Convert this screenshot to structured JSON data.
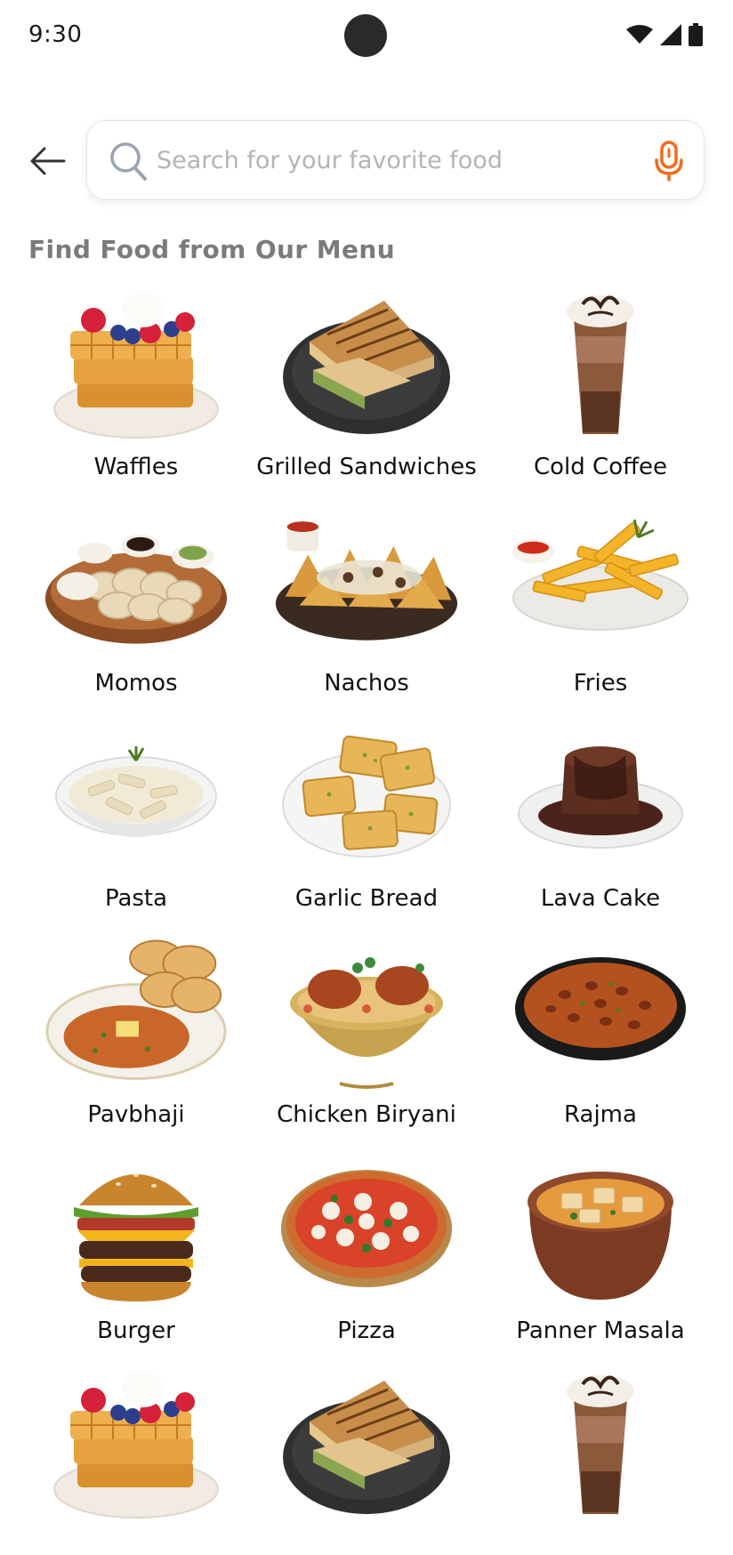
{
  "status_bar": {
    "time": "9:30",
    "icons": [
      "wifi-icon",
      "signal-icon",
      "battery-icon"
    ]
  },
  "header": {
    "back_icon": "arrow-left-icon",
    "search": {
      "placeholder": "Search for your favorite food",
      "value": "",
      "search_icon": "magnifier-icon",
      "mic_icon": "microphone-icon"
    }
  },
  "menu": {
    "title": "Find Food from Our Menu",
    "items": [
      {
        "label": "Waffles",
        "icon": "waffles-image"
      },
      {
        "label": "Grilled Sandwiches",
        "icon": "grilled-sandwich-image"
      },
      {
        "label": "Cold Coffee",
        "icon": "cold-coffee-image"
      },
      {
        "label": "Momos",
        "icon": "momos-image"
      },
      {
        "label": "Nachos",
        "icon": "nachos-image"
      },
      {
        "label": "Fries",
        "icon": "fries-image"
      },
      {
        "label": "Pasta",
        "icon": "pasta-image"
      },
      {
        "label": "Garlic Bread",
        "icon": "garlic-bread-image"
      },
      {
        "label": "Lava Cake",
        "icon": "lava-cake-image"
      },
      {
        "label": "Pavbhaji",
        "icon": "pavbhaji-image"
      },
      {
        "label": "Chicken Biryani",
        "icon": "chicken-biryani-image"
      },
      {
        "label": "Rajma",
        "icon": "rajma-image"
      },
      {
        "label": "Burger",
        "icon": "burger-image"
      },
      {
        "label": "Pizza",
        "icon": "pizza-image"
      },
      {
        "label": "Panner Masala",
        "icon": "panner-masala-image"
      },
      {
        "label": "",
        "icon": "waffles-image"
      },
      {
        "label": "",
        "icon": "grilled-sandwich-image"
      },
      {
        "label": "",
        "icon": "cold-coffee-image"
      }
    ]
  },
  "colors": {
    "accent": "#f26a1b",
    "placeholder": "#b4b4b4",
    "section_title": "#7b7b7b"
  }
}
